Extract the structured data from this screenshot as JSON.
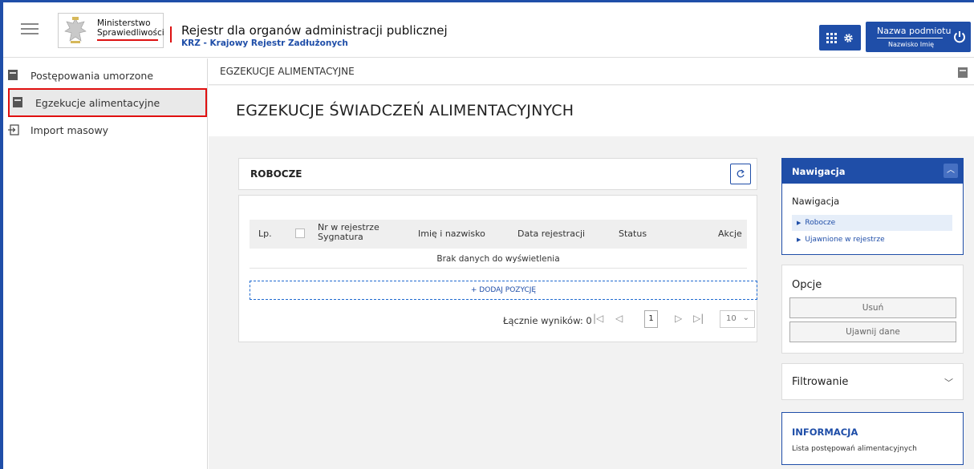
{
  "header": {
    "logo_line1": "Ministerstwo",
    "logo_line2": "Sprawiedliwości",
    "title": "Rejestr dla organów administracji publicznej",
    "subtitle": "KRZ - Krajowy Rejestr Zadłużonych",
    "user_name": "Nazwa podmiotu",
    "user_sub": "Nazwisko Imię",
    "icons": [
      "menu-icon",
      "apps-grid-icon",
      "gear-icon",
      "power-icon"
    ]
  },
  "sidebar": {
    "items": [
      {
        "label": "Postępowania umorzone",
        "icon": "folder-icon"
      },
      {
        "label": "Egzekucje alimentacyjne",
        "icon": "folder-icon",
        "active": true
      },
      {
        "label": "Import masowy",
        "icon": "import-icon"
      }
    ]
  },
  "main": {
    "breadcrumb": "EGZEKUCJE ALIMENTACYJNE",
    "page_title": "EGZEKUCJE ŚWIADCZEŃ ALIMENTACYJNYCH",
    "robocze": {
      "title": "ROBOCZE",
      "columns": {
        "lp": "Lp.",
        "nr_line1": "Nr w rejestrze",
        "nr_line2": "Sygnatura",
        "name": "Imię i nazwisko",
        "date": "Data rejestracji",
        "status": "Status",
        "actions": "Akcje"
      },
      "empty_text": "Brak danych do wyświetlenia",
      "add_label": "+ DODAJ POZYCJĘ",
      "total_label": "Łącznie wyników: 0",
      "page": "1",
      "page_size": "10"
    }
  },
  "right": {
    "nav": {
      "header": "Nawigacja",
      "subtitle": "Nawigacja",
      "links": [
        "Robocze",
        "Ujawnione w rejestrze"
      ]
    },
    "options": {
      "title": "Opcje",
      "buttons": [
        "Usuń",
        "Ujawnij dane"
      ]
    },
    "filter": {
      "title": "Filtrowanie"
    },
    "info": {
      "title": "INFORMACJA",
      "text": "Lista postępowań alimentacyjnych"
    }
  },
  "colors": {
    "primary": "#1f4ea8",
    "accent_red": "#e01010",
    "background": "#f2f2f2"
  }
}
